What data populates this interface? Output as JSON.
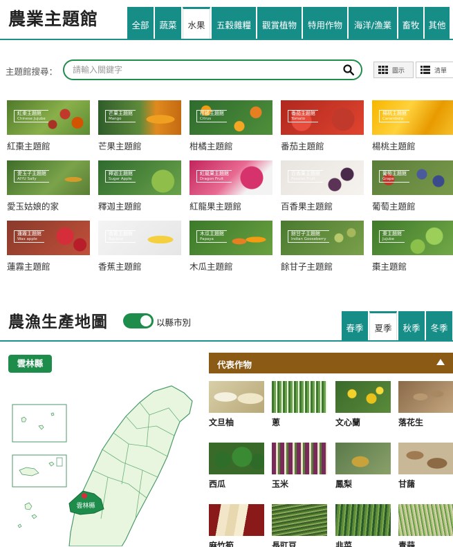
{
  "theme_hall": {
    "title": "農業主題館",
    "tabs": [
      {
        "label": "全部",
        "active": false
      },
      {
        "label": "蔬菜",
        "active": false
      },
      {
        "label": "水果",
        "active": true
      },
      {
        "label": "五穀雜糧",
        "active": false
      },
      {
        "label": "觀賞植物",
        "active": false
      },
      {
        "label": "特用作物",
        "active": false
      },
      {
        "label": "海洋/漁業",
        "active": false
      },
      {
        "label": "畜牧",
        "active": false
      },
      {
        "label": "其他",
        "active": false
      }
    ],
    "search": {
      "label": "主題館搜尋：",
      "placeholder": "請輸入關鍵字"
    },
    "view": {
      "grid_label": "圖示",
      "list_label": "清單"
    },
    "cards": [
      {
        "label": "紅棗主題館",
        "tag": "紅棗主題館",
        "tag_en": "Chinese Jujube"
      },
      {
        "label": "芒果主題館",
        "tag": "芒果主題館",
        "tag_en": "Mango"
      },
      {
        "label": "柑橘主題館",
        "tag": "柑橘主題館",
        "tag_en": "Citrus"
      },
      {
        "label": "番茄主題館",
        "tag": "番茄主題館",
        "tag_en": "Tomato"
      },
      {
        "label": "楊桃主題館",
        "tag": "楊桃主題館",
        "tag_en": "Carambola"
      },
      {
        "label": "愛玉姑娘的家",
        "tag": "愛玉子主題館",
        "tag_en": "AIYU Sally"
      },
      {
        "label": "釋迦主題館",
        "tag": "釋迦主題館",
        "tag_en": "Sugar Apple"
      },
      {
        "label": "紅龍果主題館",
        "tag": "紅龍果主題館",
        "tag_en": "Dragon Fruit"
      },
      {
        "label": "百香果主題館",
        "tag": "百香果主題館",
        "tag_en": "Passion Fruit"
      },
      {
        "label": "葡萄主題館",
        "tag": "葡萄主題館",
        "tag_en": "Grape"
      },
      {
        "label": "蓮霧主題館",
        "tag": "蓮霧主題館",
        "tag_en": "Wax apple"
      },
      {
        "label": "香蕉主題館",
        "tag": "香蕉主題館",
        "tag_en": "Banana"
      },
      {
        "label": "木瓜主題館",
        "tag": "木瓜主題館",
        "tag_en": "Papaya"
      },
      {
        "label": "餘甘子主題館",
        "tag": "餘甘子主題館",
        "tag_en": "Indian Gooseberry"
      },
      {
        "label": "棗主題館",
        "tag": "棗主題館",
        "tag_en": "Jujube"
      }
    ]
  },
  "production_map": {
    "title": "農漁生產地圖",
    "toggle_label": "以縣市別",
    "toggle_on": true,
    "season_tabs": [
      {
        "label": "春季",
        "active": false
      },
      {
        "label": "夏季",
        "active": true
      },
      {
        "label": "秋季",
        "active": false
      },
      {
        "label": "冬季",
        "active": false
      }
    ],
    "county": "雲林縣",
    "map_marker_label": "雲林縣",
    "crops_header": "代表作物",
    "crops": [
      {
        "name": "文旦柚"
      },
      {
        "name": "蔥"
      },
      {
        "name": "文心蘭"
      },
      {
        "name": "落花生"
      },
      {
        "name": "西瓜"
      },
      {
        "name": "玉米"
      },
      {
        "name": "鳳梨"
      },
      {
        "name": "甘藷"
      },
      {
        "name": "麻竹筍"
      },
      {
        "name": "長豇豆"
      },
      {
        "name": "韭菜"
      },
      {
        "name": "青蒜"
      }
    ]
  },
  "colors": {
    "teal": "#178d88",
    "green": "#1e8d4c",
    "brown": "#8b5a14"
  }
}
